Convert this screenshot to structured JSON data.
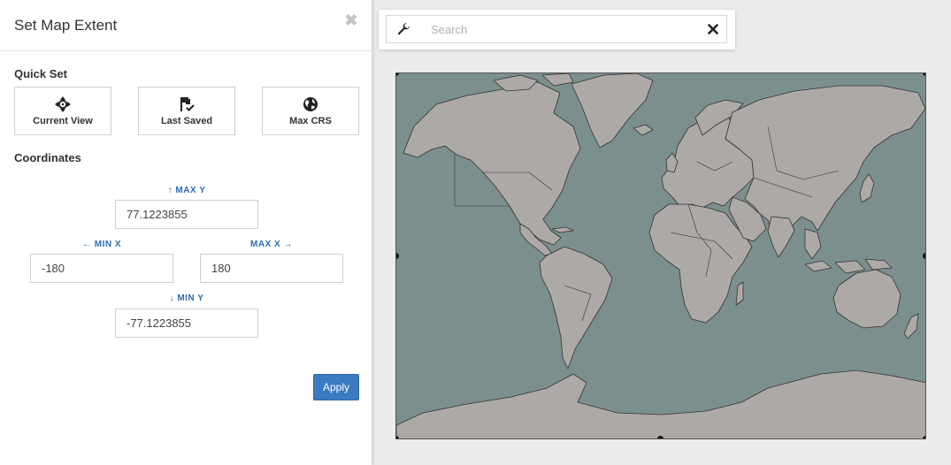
{
  "panel": {
    "title": "Set Map Extent",
    "close_icon": "close-icon"
  },
  "quick_set": {
    "heading": "Quick Set",
    "buttons": [
      {
        "label": "Current View",
        "icon": "crosshair-move-icon"
      },
      {
        "label": "Last Saved",
        "icon": "flag-check-icon"
      },
      {
        "label": "Max CRS",
        "icon": "globe-icon"
      }
    ]
  },
  "coordinates": {
    "heading": "Coordinates",
    "max_y": {
      "label": "↑ MAX Y",
      "value": "77.1223855"
    },
    "min_x": {
      "label": "← MIN X",
      "value": "-180"
    },
    "max_x": {
      "label": "MAX X →",
      "value": "180"
    },
    "min_y": {
      "label": "↓ MIN Y",
      "value": "-77.1223855"
    }
  },
  "apply_label": "Apply",
  "search": {
    "placeholder": "Search",
    "value": "",
    "tool_icon": "wrench-icon",
    "clear_icon": "close-icon"
  },
  "map": {
    "ocean_color": "#7c8f8f",
    "land_color": "#aca9a7",
    "border_color": "#333333"
  }
}
